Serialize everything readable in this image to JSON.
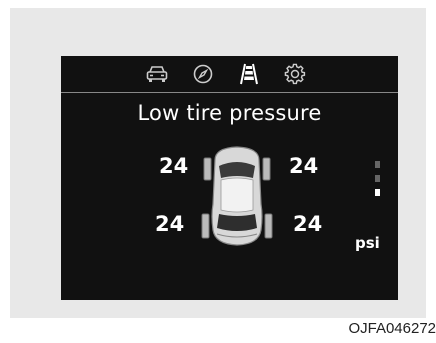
{
  "display": {
    "tabs": [
      {
        "icon": "car-icon",
        "active": false
      },
      {
        "icon": "compass-icon",
        "active": false
      },
      {
        "icon": "road-lane-icon",
        "active": true
      },
      {
        "icon": "gear-icon",
        "active": false
      }
    ],
    "title": "Low tire pressure",
    "tires": {
      "front_left": "24",
      "front_right": "24",
      "rear_left": "24",
      "rear_right": "24"
    },
    "unit": "psi",
    "page_indicator": {
      "count": 3,
      "active_index": 2
    }
  },
  "caption": {
    "code": "OJFA046272"
  },
  "colors": {
    "screen_background": "#111111",
    "text": "#ffffff",
    "panel_background": "#e8e8e8"
  }
}
